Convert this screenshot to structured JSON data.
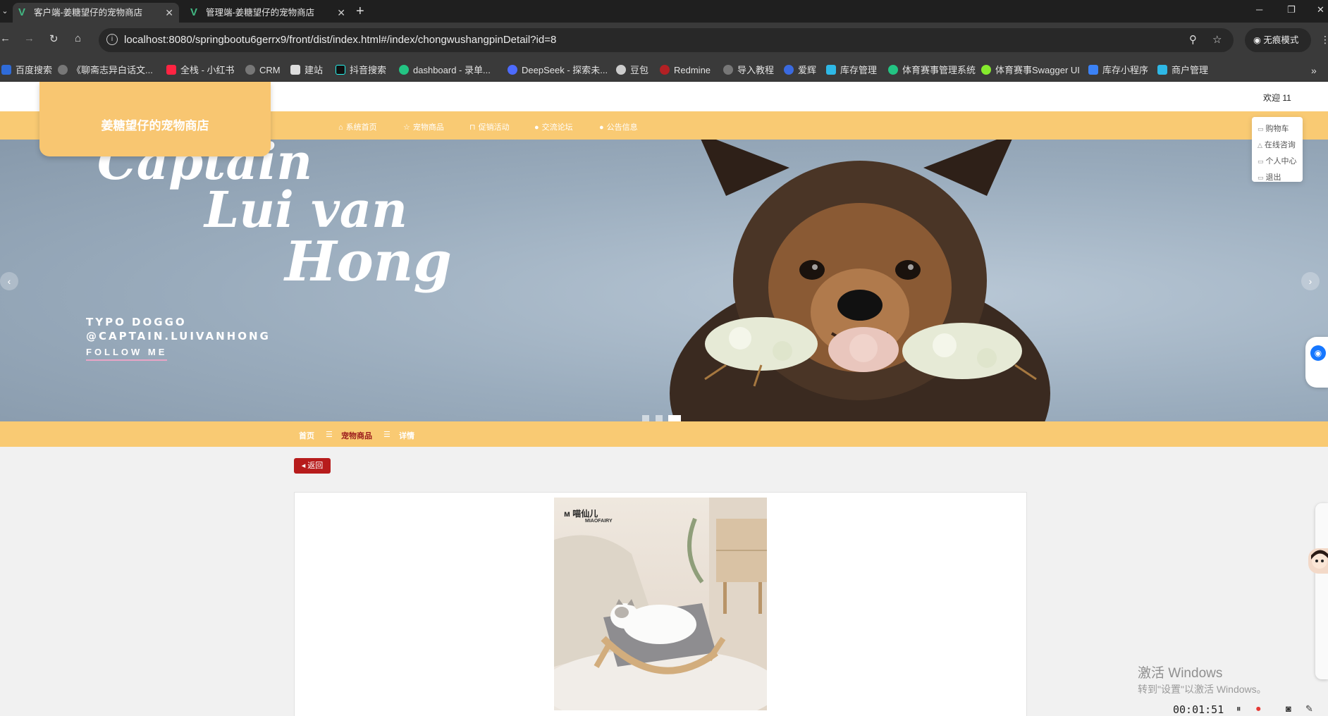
{
  "browser": {
    "tabs": [
      {
        "title": "客户端-姜糖望仔的宠物商店",
        "active": true
      },
      {
        "title": "管理端-姜糖望仔的宠物商店",
        "active": false
      }
    ],
    "url": "localhost:8080/springbootu6gerrx9/front/dist/index.html#/index/chongwushangpinDetail?id=8",
    "incognito_label": "无痕模式",
    "bookmarks": [
      "百度搜索",
      "《聊斋志异白话文...",
      "全栈 - 小红书",
      "CRM",
      "建站",
      "抖音搜索",
      "dashboard - 录单...",
      "DeepSeek - 探索未...",
      "豆包",
      "Redmine",
      "导入教程",
      "爱辉",
      "库存管理",
      "体育赛事管理系统",
      "体育赛事Swagger UI",
      "库存小程序",
      "商户管理"
    ]
  },
  "header": {
    "welcome": "欢迎 11",
    "logo_text": "姜糖望仔的宠物商店",
    "nav": [
      {
        "label": "系统首页",
        "icon": "home-icon"
      },
      {
        "label": "宠物商品",
        "icon": "star-icon"
      },
      {
        "label": "促销活动",
        "icon": "bag-icon"
      },
      {
        "label": "交流论坛",
        "icon": "chat-icon"
      },
      {
        "label": "公告信息",
        "icon": "notice-icon"
      }
    ],
    "user_menu": [
      "购物车",
      "在线咨询",
      "个人中心",
      "退出"
    ]
  },
  "banner": {
    "script_lines": [
      "Captain",
      "Lui van",
      "Hong"
    ],
    "typo_lines": [
      "TYPO DOGGO",
      "@CAPTAIN.LUIVANHONG"
    ],
    "follow": "FOLLOW ME",
    "slides": 3,
    "active_slide": 3
  },
  "breadcrumb": {
    "items": [
      "首页",
      "宠物商品",
      "详情"
    ],
    "separator": "☰"
  },
  "detail": {
    "back_label": "返回",
    "brand": "喵仙儿",
    "brand_sub": "MIAOFAIRY"
  },
  "overlay": {
    "activate_title": "激活 Windows",
    "activate_sub": "转到\"设置\"以激活 Windows。",
    "record_time": "00:01:51"
  },
  "colors": {
    "accent": "#f9ca73",
    "logo_bg": "#f8c671",
    "back_button": "#b71c1c",
    "crumb_current": "#9b1b1b"
  }
}
